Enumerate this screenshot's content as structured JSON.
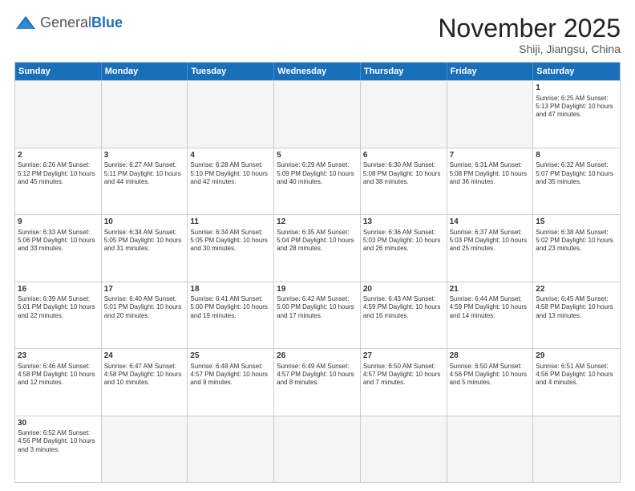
{
  "logo": {
    "general": "General",
    "blue": "Blue"
  },
  "header": {
    "month": "November 2025",
    "location": "Shiji, Jiangsu, China"
  },
  "weekdays": [
    "Sunday",
    "Monday",
    "Tuesday",
    "Wednesday",
    "Thursday",
    "Friday",
    "Saturday"
  ],
  "rows": [
    [
      {
        "day": "",
        "text": "",
        "empty": true
      },
      {
        "day": "",
        "text": "",
        "empty": true
      },
      {
        "day": "",
        "text": "",
        "empty": true
      },
      {
        "day": "",
        "text": "",
        "empty": true
      },
      {
        "day": "",
        "text": "",
        "empty": true
      },
      {
        "day": "",
        "text": "",
        "empty": true
      },
      {
        "day": "1",
        "text": "Sunrise: 6:25 AM\nSunset: 5:13 PM\nDaylight: 10 hours\nand 47 minutes.",
        "empty": false
      }
    ],
    [
      {
        "day": "2",
        "text": "Sunrise: 6:26 AM\nSunset: 5:12 PM\nDaylight: 10 hours\nand 45 minutes.",
        "empty": false
      },
      {
        "day": "3",
        "text": "Sunrise: 6:27 AM\nSunset: 5:11 PM\nDaylight: 10 hours\nand 44 minutes.",
        "empty": false
      },
      {
        "day": "4",
        "text": "Sunrise: 6:28 AM\nSunset: 5:10 PM\nDaylight: 10 hours\nand 42 minutes.",
        "empty": false
      },
      {
        "day": "5",
        "text": "Sunrise: 6:29 AM\nSunset: 5:09 PM\nDaylight: 10 hours\nand 40 minutes.",
        "empty": false
      },
      {
        "day": "6",
        "text": "Sunrise: 6:30 AM\nSunset: 5:08 PM\nDaylight: 10 hours\nand 38 minutes.",
        "empty": false
      },
      {
        "day": "7",
        "text": "Sunrise: 6:31 AM\nSunset: 5:08 PM\nDaylight: 10 hours\nand 36 minutes.",
        "empty": false
      },
      {
        "day": "8",
        "text": "Sunrise: 6:32 AM\nSunset: 5:07 PM\nDaylight: 10 hours\nand 35 minutes.",
        "empty": false
      }
    ],
    [
      {
        "day": "9",
        "text": "Sunrise: 6:33 AM\nSunset: 5:06 PM\nDaylight: 10 hours\nand 33 minutes.",
        "empty": false
      },
      {
        "day": "10",
        "text": "Sunrise: 6:34 AM\nSunset: 5:05 PM\nDaylight: 10 hours\nand 31 minutes.",
        "empty": false
      },
      {
        "day": "11",
        "text": "Sunrise: 6:34 AM\nSunset: 5:05 PM\nDaylight: 10 hours\nand 30 minutes.",
        "empty": false
      },
      {
        "day": "12",
        "text": "Sunrise: 6:35 AM\nSunset: 5:04 PM\nDaylight: 10 hours\nand 28 minutes.",
        "empty": false
      },
      {
        "day": "13",
        "text": "Sunrise: 6:36 AM\nSunset: 5:03 PM\nDaylight: 10 hours\nand 26 minutes.",
        "empty": false
      },
      {
        "day": "14",
        "text": "Sunrise: 6:37 AM\nSunset: 5:03 PM\nDaylight: 10 hours\nand 25 minutes.",
        "empty": false
      },
      {
        "day": "15",
        "text": "Sunrise: 6:38 AM\nSunset: 5:02 PM\nDaylight: 10 hours\nand 23 minutes.",
        "empty": false
      }
    ],
    [
      {
        "day": "16",
        "text": "Sunrise: 6:39 AM\nSunset: 5:01 PM\nDaylight: 10 hours\nand 22 minutes.",
        "empty": false
      },
      {
        "day": "17",
        "text": "Sunrise: 6:40 AM\nSunset: 5:01 PM\nDaylight: 10 hours\nand 20 minutes.",
        "empty": false
      },
      {
        "day": "18",
        "text": "Sunrise: 6:41 AM\nSunset: 5:00 PM\nDaylight: 10 hours\nand 19 minutes.",
        "empty": false
      },
      {
        "day": "19",
        "text": "Sunrise: 6:42 AM\nSunset: 5:00 PM\nDaylight: 10 hours\nand 17 minutes.",
        "empty": false
      },
      {
        "day": "20",
        "text": "Sunrise: 6:43 AM\nSunset: 4:59 PM\nDaylight: 10 hours\nand 16 minutes.",
        "empty": false
      },
      {
        "day": "21",
        "text": "Sunrise: 6:44 AM\nSunset: 4:59 PM\nDaylight: 10 hours\nand 14 minutes.",
        "empty": false
      },
      {
        "day": "22",
        "text": "Sunrise: 6:45 AM\nSunset: 4:58 PM\nDaylight: 10 hours\nand 13 minutes.",
        "empty": false
      }
    ],
    [
      {
        "day": "23",
        "text": "Sunrise: 6:46 AM\nSunset: 4:58 PM\nDaylight: 10 hours\nand 12 minutes.",
        "empty": false
      },
      {
        "day": "24",
        "text": "Sunrise: 6:47 AM\nSunset: 4:58 PM\nDaylight: 10 hours\nand 10 minutes.",
        "empty": false
      },
      {
        "day": "25",
        "text": "Sunrise: 6:48 AM\nSunset: 4:57 PM\nDaylight: 10 hours\nand 9 minutes.",
        "empty": false
      },
      {
        "day": "26",
        "text": "Sunrise: 6:49 AM\nSunset: 4:57 PM\nDaylight: 10 hours\nand 8 minutes.",
        "empty": false
      },
      {
        "day": "27",
        "text": "Sunrise: 6:50 AM\nSunset: 4:57 PM\nDaylight: 10 hours\nand 7 minutes.",
        "empty": false
      },
      {
        "day": "28",
        "text": "Sunrise: 6:50 AM\nSunset: 4:56 PM\nDaylight: 10 hours\nand 5 minutes.",
        "empty": false
      },
      {
        "day": "29",
        "text": "Sunrise: 6:51 AM\nSunset: 4:56 PM\nDaylight: 10 hours\nand 4 minutes.",
        "empty": false
      }
    ],
    [
      {
        "day": "30",
        "text": "Sunrise: 6:52 AM\nSunset: 4:56 PM\nDaylight: 10 hours\nand 3 minutes.",
        "empty": false
      },
      {
        "day": "",
        "text": "",
        "empty": true
      },
      {
        "day": "",
        "text": "",
        "empty": true
      },
      {
        "day": "",
        "text": "",
        "empty": true
      },
      {
        "day": "",
        "text": "",
        "empty": true
      },
      {
        "day": "",
        "text": "",
        "empty": true
      },
      {
        "day": "",
        "text": "",
        "empty": true
      }
    ]
  ]
}
